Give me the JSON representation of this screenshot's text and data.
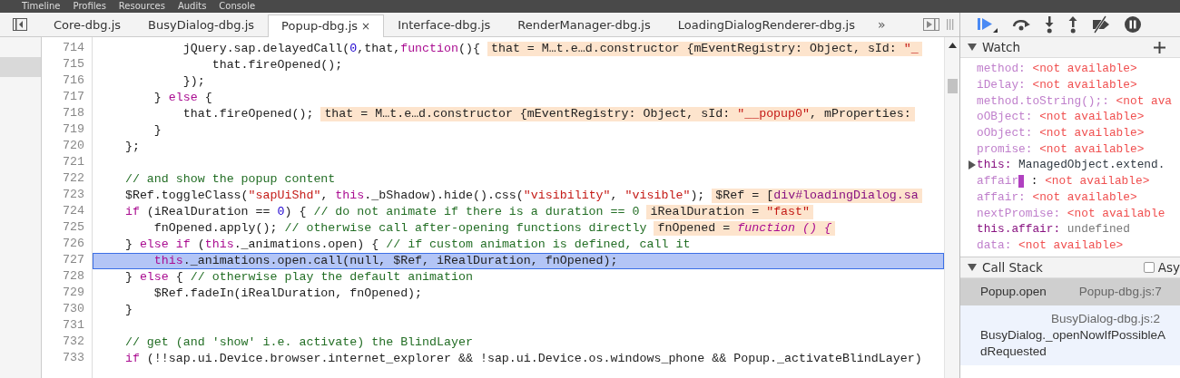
{
  "top_menu": [
    "Timeline",
    "Profiles",
    "Resources",
    "Audits",
    "Console"
  ],
  "tabs": [
    {
      "label": "Core-dbg.js",
      "selected": false
    },
    {
      "label": "BusyDialog-dbg.js",
      "selected": false
    },
    {
      "label": "Popup-dbg.js",
      "selected": true,
      "close": "×"
    },
    {
      "label": "Interface-dbg.js",
      "selected": false
    },
    {
      "label": "RenderManager-dbg.js",
      "selected": false
    },
    {
      "label": "LoadingDialogRenderer-dbg.js",
      "selected": false
    }
  ],
  "tabs_overflow": "»",
  "code": [
    {
      "number": "714",
      "current": false,
      "tokens": [
        {
          "kind": "plain",
          "text": "            jQuery.sap.delayedCall("
        },
        {
          "kind": "number",
          "text": "0"
        },
        {
          "kind": "plain",
          "text": ",that,"
        },
        {
          "kind": "keyword",
          "text": "function"
        },
        {
          "kind": "plain",
          "text": "(){"
        }
      ],
      "inline": [
        {
          "kind": "plain",
          "text": "that = M…t.e…d.constructor {mEventRegistry: Object, sId: "
        },
        {
          "kind": "string",
          "text": "\"_"
        }
      ]
    },
    {
      "number": "715",
      "current": false,
      "tokens": [
        {
          "kind": "plain",
          "text": "                that.fireOpened();"
        }
      ]
    },
    {
      "number": "716",
      "current": false,
      "tokens": [
        {
          "kind": "plain",
          "text": "            });"
        }
      ]
    },
    {
      "number": "717",
      "current": false,
      "tokens": [
        {
          "kind": "plain",
          "text": "        } "
        },
        {
          "kind": "keyword",
          "text": "else"
        },
        {
          "kind": "plain",
          "text": " {"
        }
      ]
    },
    {
      "number": "718",
      "current": false,
      "tokens": [
        {
          "kind": "plain",
          "text": "            that.fireOpened();"
        }
      ],
      "inline": [
        {
          "kind": "plain",
          "text": "that = M…t.e…d.constructor {mEventRegistry: Object, sId: "
        },
        {
          "kind": "string",
          "text": "\"__popup0\""
        },
        {
          "kind": "plain",
          "text": ", mProperties:"
        }
      ]
    },
    {
      "number": "719",
      "current": false,
      "tokens": [
        {
          "kind": "plain",
          "text": "        }"
        }
      ]
    },
    {
      "number": "720",
      "current": false,
      "tokens": [
        {
          "kind": "plain",
          "text": "    };"
        }
      ]
    },
    {
      "number": "721",
      "current": false
    },
    {
      "number": "722",
      "current": false,
      "tokens": [
        {
          "kind": "comment",
          "text": "    // and show the popup content"
        }
      ]
    },
    {
      "number": "723",
      "current": false,
      "tokens": [
        {
          "kind": "plain",
          "text": "    $Ref.toggleClass("
        },
        {
          "kind": "string",
          "text": "\"sapUiShd\""
        },
        {
          "kind": "plain",
          "text": ", "
        },
        {
          "kind": "keyword",
          "text": "this"
        },
        {
          "kind": "plain",
          "text": "._bShadow).hide().css("
        },
        {
          "kind": "string",
          "text": "\"visibility\""
        },
        {
          "kind": "plain",
          "text": ", "
        },
        {
          "kind": "string",
          "text": "\"visible\""
        },
        {
          "kind": "plain",
          "text": ");"
        }
      ],
      "inline": [
        {
          "kind": "plain",
          "text": "$Ref = ["
        },
        {
          "kind": "tag",
          "text": "div#loadingDialog.sa"
        }
      ]
    },
    {
      "number": "724",
      "current": false,
      "tokens": [
        {
          "kind": "keyword",
          "text": "    if"
        },
        {
          "kind": "plain",
          "text": " (iRealDuration == "
        },
        {
          "kind": "number",
          "text": "0"
        },
        {
          "kind": "plain",
          "text": ") { "
        },
        {
          "kind": "comment",
          "text": "// do not animate if there is a duration == 0"
        }
      ],
      "inline": [
        {
          "kind": "plain",
          "text": "iRealDuration = "
        },
        {
          "kind": "string",
          "text": "\"fast\""
        }
      ]
    },
    {
      "number": "725",
      "current": false,
      "tokens": [
        {
          "kind": "plain",
          "text": "        fnOpened.apply(); "
        },
        {
          "kind": "comment",
          "text": "// otherwise call after-opening functions directly"
        }
      ],
      "inline": [
        {
          "kind": "plain",
          "text": "fnOpened = "
        },
        {
          "kind": "italic",
          "text": "function () {"
        }
      ]
    },
    {
      "number": "726",
      "current": false,
      "tokens": [
        {
          "kind": "plain",
          "text": "    } "
        },
        {
          "kind": "keyword",
          "text": "else if"
        },
        {
          "kind": "plain",
          "text": " ("
        },
        {
          "kind": "keyword",
          "text": "this"
        },
        {
          "kind": "plain",
          "text": "._animations.open) { "
        },
        {
          "kind": "comment",
          "text": "// if custom animation is defined, call it"
        }
      ]
    },
    {
      "number": "727",
      "current": true,
      "tokens": [
        {
          "kind": "keyword",
          "text": "        this"
        },
        {
          "kind": "plain",
          "text": "._animations.open.call(null, $Ref, iRealDuration, fnOpened);"
        }
      ]
    },
    {
      "number": "728",
      "current": false,
      "tokens": [
        {
          "kind": "plain",
          "text": "    } "
        },
        {
          "kind": "keyword",
          "text": "else"
        },
        {
          "kind": "plain",
          "text": " { "
        },
        {
          "kind": "comment",
          "text": "// otherwise play the default animation"
        }
      ]
    },
    {
      "number": "729",
      "current": false,
      "tokens": [
        {
          "kind": "plain",
          "text": "        $Ref.fadeIn(iRealDuration, fnOpened);"
        }
      ]
    },
    {
      "number": "730",
      "current": false,
      "tokens": [
        {
          "kind": "plain",
          "text": "    }"
        }
      ]
    },
    {
      "number": "731",
      "current": false
    },
    {
      "number": "732",
      "current": false,
      "tokens": [
        {
          "kind": "comment",
          "text": "    // get (and 'show' i.e. activate) the BlindLayer"
        }
      ]
    },
    {
      "number": "733",
      "current": false,
      "tokens": [
        {
          "kind": "keyword",
          "text": "    if"
        },
        {
          "kind": "plain",
          "text": " (!!sap.ui.Device.browser.internet_explorer && !sap.ui.Device.os.windows_phone && Popup._activateBlindLayer)"
        }
      ]
    }
  ],
  "watch": {
    "title": "Watch",
    "expanded": true,
    "items": [
      {
        "kind": "unavailable",
        "name": "method:",
        "value": "<not available>"
      },
      {
        "kind": "unavailable",
        "name": "iDelay:",
        "value": "<not available>"
      },
      {
        "kind": "unavailable",
        "name": "method.toString();:",
        "value": "<not ava"
      },
      {
        "kind": "unavailable",
        "name": "oOBject:",
        "value": "<not available>"
      },
      {
        "kind": "unavailable",
        "name": "oObject:",
        "value": "<not available>"
      },
      {
        "kind": "unavailable",
        "name": "promise:",
        "value": "<not available>"
      },
      {
        "kind": "object",
        "name": "this:",
        "value": "ManagedObject.extend.",
        "expanded": false
      },
      {
        "kind": "editing",
        "name": "affair",
        "separator": ":",
        "value": "<not available>"
      },
      {
        "kind": "unavailable",
        "name": "affair:",
        "value": "<not available>"
      },
      {
        "kind": "unavailable",
        "name": "nextPromise:",
        "value": "<not available"
      },
      {
        "kind": "value",
        "name": "this.affair:",
        "value": "undefined"
      },
      {
        "kind": "unavailable",
        "name": "data:",
        "value": "<not available>"
      }
    ]
  },
  "call_stack": {
    "title": "Call Stack",
    "expanded": true,
    "async": {
      "label": "Asy",
      "checked": false
    },
    "frames": [
      {
        "name_lines": [
          "Popup.open"
        ],
        "location": "Popup-dbg.js:7",
        "selected": true
      },
      {
        "name_lines": [
          "BusyDialog._openNowIfPossibleA",
          "dRequested"
        ],
        "location": "BusyDialog-dbg.js:2",
        "selected": false
      }
    ]
  }
}
